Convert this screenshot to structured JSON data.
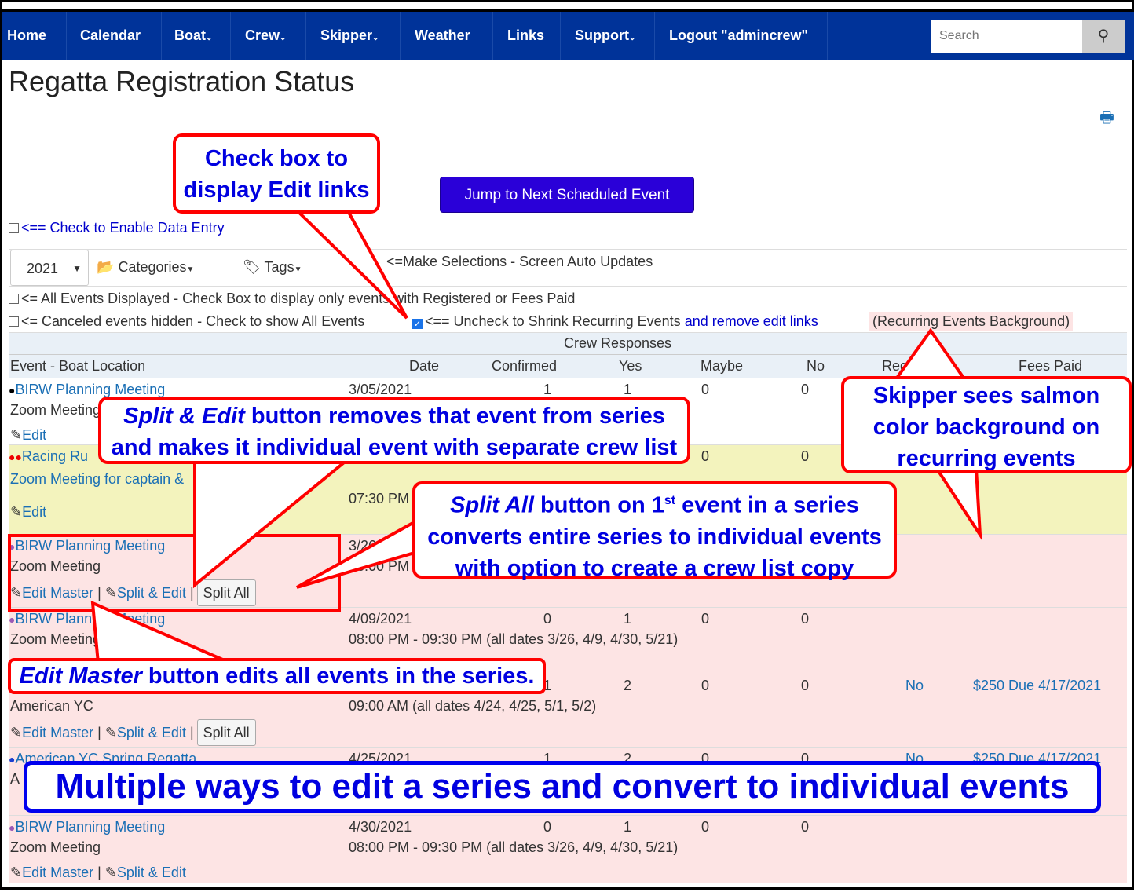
{
  "nav": {
    "items": [
      "Home",
      "Calendar",
      "Boat",
      "Crew",
      "Skipper",
      "Weather",
      "Links",
      "Support",
      "Logout \"admincrew\""
    ],
    "search_placeholder": "Search"
  },
  "page": {
    "title": "Regatta Registration Status",
    "jump_button": "Jump to Next Scheduled Event",
    "enable_entry": "<== Check to Enable Data Entry",
    "year": "2021",
    "categories": "Categories",
    "tags": "Tags",
    "make_selections": "<=Make Selections - Screen Auto Updates",
    "all_events": "<= All Events Displayed - Check Box to display only events with Registered or Fees Paid",
    "canceled": "<= Canceled events hidden - Check to show All Events",
    "shrink_a": "<== Uncheck to Shrink Recurring Events",
    "shrink_b": "and remove edit links",
    "recurring_bg": "(Recurring Events Background)"
  },
  "table": {
    "group_header": "Crew Responses",
    "headers": [
      "Event - Boat Location",
      "Date",
      "Confirmed",
      "Yes",
      "Maybe",
      "No",
      "Registered",
      "Fees Paid"
    ],
    "rows": [
      {
        "title": "BIRW Planning Meeting",
        "date": "3/05/2021",
        "confirmed": "1",
        "yes": "1",
        "maybe": "0",
        "no": "0",
        "line2": "Zoom Meeting",
        "edit": "Edit"
      },
      {
        "title": "Racing Ru",
        "date": "",
        "maybe": "0",
        "no": "0",
        "line2": "Zoom Meeting for captain &",
        "time": "07:30 PM",
        "edit": "Edit"
      },
      {
        "title": "BIRW Planning Meeting",
        "date": "3/26/2021",
        "line2": "Zoom Meeting",
        "time": "08:00 PM",
        "edit_master": "Edit Master",
        "split_edit": "Split & Edit",
        "split_all": "Split All"
      },
      {
        "title": "BIRW Planning Meeting",
        "date": "4/09/2021",
        "confirmed": "0",
        "yes": "1",
        "maybe": "0",
        "no": "0",
        "line2": "Zoom Meeting",
        "time": "08:00 PM - 09:30 PM (all dates 3/26, 4/9, 4/30, 5/21)"
      },
      {
        "confirmed": "1",
        "yes": "2",
        "maybe": "0",
        "no": "0",
        "registered": "No",
        "fees": "$250 Due 4/17/2021",
        "line2": "American YC",
        "time": "09:00 AM (all dates 4/24, 4/25, 5/1, 5/2)",
        "edit_master": "Edit Master",
        "split_edit": "Split & Edit",
        "split_all": "Split All"
      },
      {
        "title": "American YC Spring Regatta",
        "date": "4/25/2021",
        "confirmed": "1",
        "yes": "2",
        "maybe": "0",
        "no": "0",
        "registered": "No",
        "fees": "$250 Due 4/17/2021",
        "line2": "A"
      },
      {
        "title": "BIRW Planning Meeting",
        "date": "4/30/2021",
        "confirmed": "0",
        "yes": "1",
        "maybe": "0",
        "no": "0",
        "line2": "Zoom Meeting",
        "time": "08:00 PM - 09:30 PM (all dates 3/26, 4/9, 4/30, 5/21)",
        "edit_master": "Edit Master",
        "split_edit": "Split & Edit"
      }
    ]
  },
  "annotations": {
    "checkbox": [
      "Check box to",
      "display Edit links"
    ],
    "split_edit": {
      "em": "Split & Edit",
      "l1": " button removes that event from series",
      "l2": "and makes it individual event with separate crew list"
    },
    "split_all": {
      "em": "Split All",
      "l1a": " button on 1",
      "sup": "st",
      "l1b": " event in a series",
      "l2": "converts entire series to individual events",
      "l3": "with option to create a crew list copy"
    },
    "skipper": [
      "Skipper sees salmon",
      "color background on",
      "recurring events"
    ],
    "edit_master": {
      "em": "Edit Master",
      "rest": " button edits all events in the series."
    },
    "banner": "Multiple ways to edit a series and convert to individual events"
  },
  "colors": {
    "nav": "#003399",
    "recurring": "#fde4e4",
    "highlight": "#f3f3bd",
    "callout_border": "#ff0000",
    "callout_text": "#0000e0"
  }
}
